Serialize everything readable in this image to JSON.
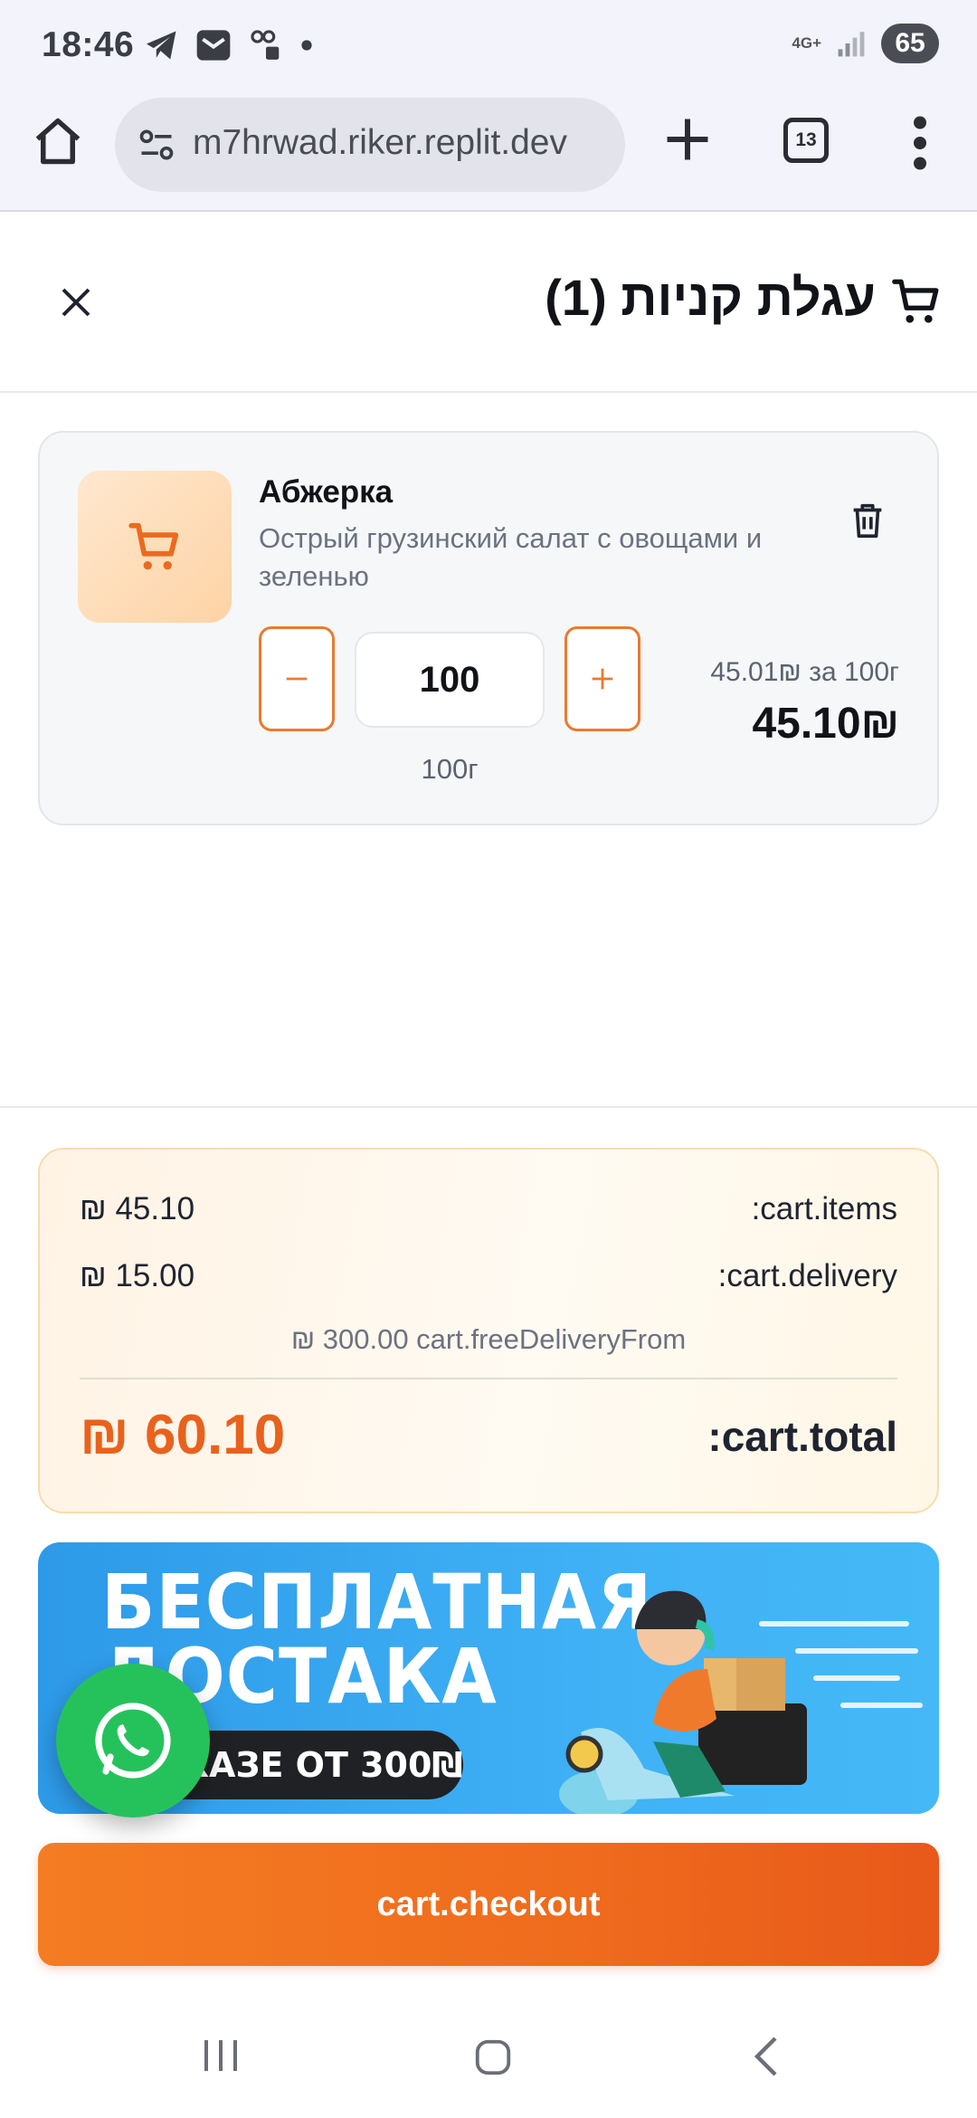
{
  "status_bar": {
    "time": "18:46",
    "network_label": "4G+",
    "battery": "65",
    "notification_icons": [
      "telegram-icon",
      "mail-icon",
      "voicemail-icon",
      "dot-icon"
    ]
  },
  "browser": {
    "url": "m7hrwad.riker.replit.dev",
    "tab_count": "13"
  },
  "cart": {
    "title": "עגלת קניות (1)",
    "item": {
      "name": "Абжерка",
      "description": "Острый грузинский салат с овощами и зеленью",
      "quantity": "100",
      "unit": "100г",
      "unit_price": "45.01₪ за 100г",
      "line_total": "45.10₪"
    },
    "summary": {
      "items_label": ":cart.items",
      "items_value": "₪ 45.10",
      "delivery_label": ":cart.delivery",
      "delivery_value": "₪ 15.00",
      "free_delivery_note": "₪ 300.00 cart.freeDeliveryFrom",
      "total_label": ":cart.total",
      "total_value": "₪ 60.10"
    },
    "banner": {
      "line1": "БЕСПЛАТНАЯ",
      "line2": "ДОСТАКА",
      "pill": "КАЗЕ ОТ 300₪"
    },
    "checkout_label": "cart.checkout"
  },
  "colors": {
    "accent": "#ef6b1d",
    "whatsapp": "#25c25c",
    "banner_blue": "#3fb0f5"
  }
}
